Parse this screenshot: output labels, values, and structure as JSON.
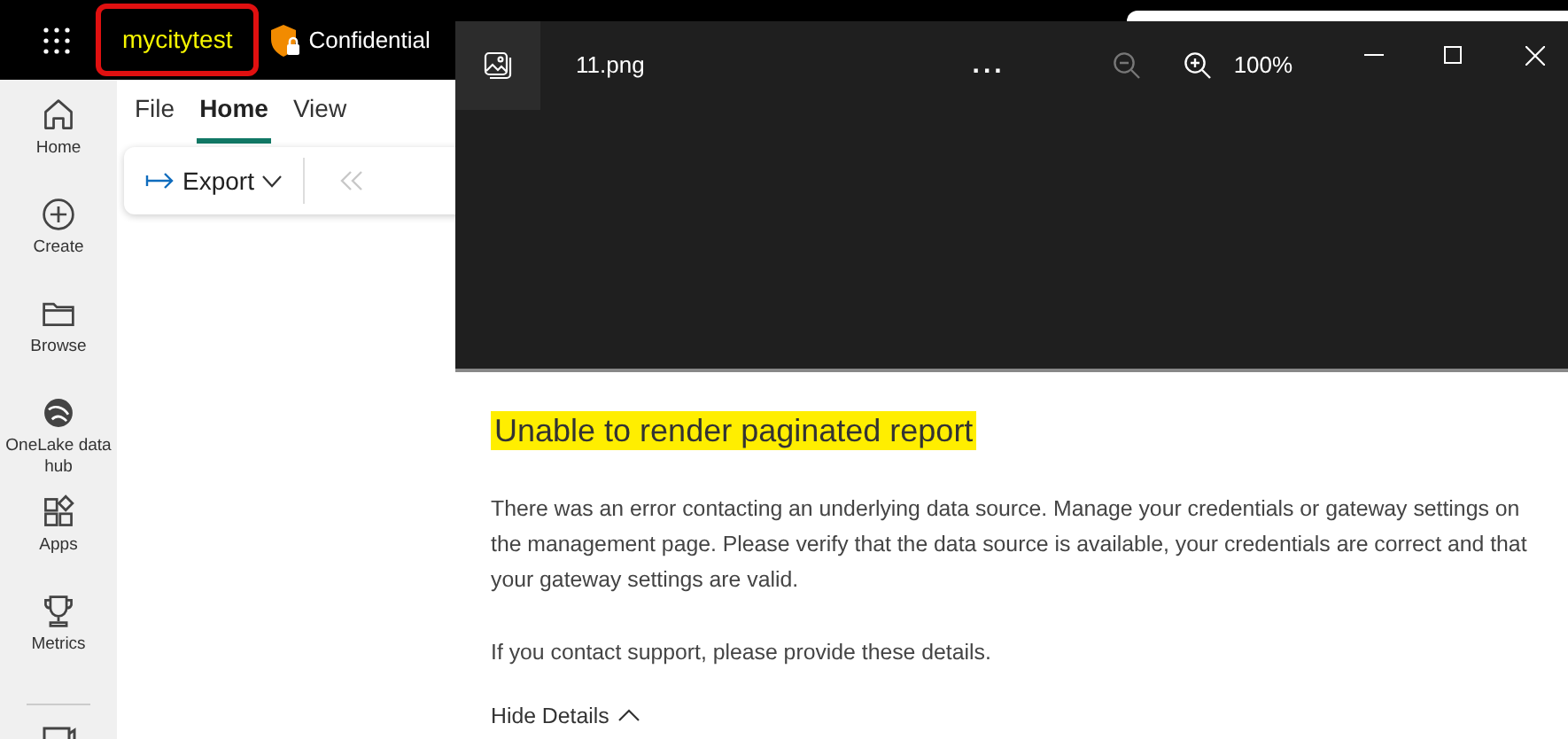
{
  "top_bar": {
    "workspace": "mycitytest",
    "label": "Confidential"
  },
  "rail": [
    {
      "label": "Home"
    },
    {
      "label": "Create"
    },
    {
      "label": "Browse"
    },
    {
      "label": "OneLake data hub"
    },
    {
      "label": "Apps"
    },
    {
      "label": "Metrics"
    }
  ],
  "menu_tabs": [
    {
      "label": "File",
      "selected": false
    },
    {
      "label": "Home",
      "selected": true
    },
    {
      "label": "View",
      "selected": false
    }
  ],
  "toolbar": {
    "export": "Export"
  },
  "viewer": {
    "filename": "11.png",
    "more": "...",
    "zoom": "100%",
    "image": {
      "title": "Unable to render paginated report",
      "message": "There was an error contacting an underlying data source. Manage your credentials or gateway settings on the management page. Please verify that the data source is available, your credentials are correct and that your gateway settings are valid.",
      "support": "If you contact support, please provide these details.",
      "details_toggle": "Hide Details"
    }
  }
}
